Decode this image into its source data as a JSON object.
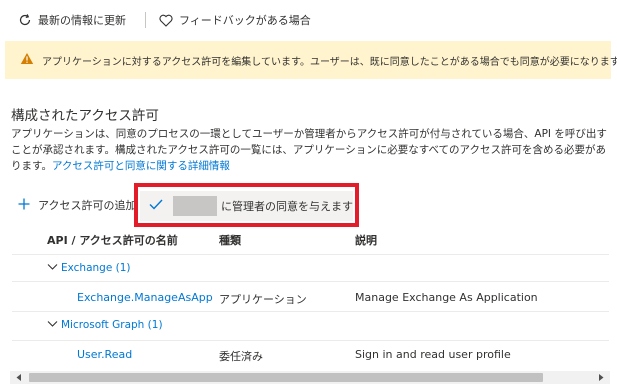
{
  "toolbar": {
    "refresh_label": "最新の情報に更新",
    "feedback_label": "フィードバックがある場合"
  },
  "banner": {
    "text": "アプリケーションに対するアクセス許可を編集しています。ユーザーは、既に同意したことがある場合でも同意が必要になります。"
  },
  "section": {
    "title": "構成されたアクセス許可",
    "description": "アプリケーションは、同意のプロセスの一環としてユーザーか管理者からアクセス許可が付与されている場合、API を呼び出すことが承認されます。構成されたアクセス許可の一覧には、アプリケーションに必要なすべてのアクセス許可を含める必要があります。",
    "link_text": "アクセス許可と同意に関する詳細情報"
  },
  "actions": {
    "add_permission": "アクセス許可の追加",
    "grant_consent_suffix": "に管理者の同意を与えます"
  },
  "table": {
    "headers": [
      "API / アクセス許可の名前",
      "種類",
      "説明"
    ],
    "groups": [
      {
        "name": "Exchange (1)",
        "rows": [
          {
            "name": "Exchange.ManageAsApp",
            "type": "アプリケーション",
            "description": "Manage Exchange As Application"
          }
        ]
      },
      {
        "name": "Microsoft Graph (1)",
        "rows": [
          {
            "name": "User.Read",
            "type": "委任済み",
            "description": "Sign in and read user profile"
          }
        ]
      }
    ]
  },
  "colors": {
    "accent": "#0078d4",
    "highlight": "#e21d29",
    "banner": "#fff4ce"
  },
  "icons": [
    "refresh-icon",
    "heart-icon",
    "warning-icon",
    "plus-icon",
    "checkmark-icon",
    "chevron-down-icon",
    "arrow-left-icon",
    "arrow-right-icon"
  ]
}
